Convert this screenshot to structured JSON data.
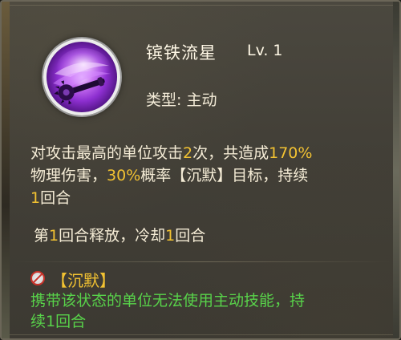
{
  "skill": {
    "name": "镔铁流星",
    "level": "Lv. 1",
    "type_label": "类型",
    "type_value": "主动",
    "icon": "purple-meteor-mace-icon"
  },
  "description": {
    "line1_a": "对攻击最高的单位攻击",
    "line1_b": "2",
    "line1_c": "次，共造成",
    "line1_d": "170%",
    "line2_a": "物理伤害，",
    "line2_b": "30%",
    "line2_c": "概率【沉默】目标，持续",
    "line3_a": "1",
    "line3_b": "回合"
  },
  "cooldown": {
    "a": "第",
    "b": "1",
    "c": "回合释放，冷却",
    "d": "1",
    "e": "回合"
  },
  "status": {
    "icon": "silence-icon",
    "name": "【沉默】",
    "desc_line1": "携带该状态的单位无法使用主动技能，持",
    "desc_line2": "续1回合"
  },
  "colors": {
    "highlight": "#f2c232",
    "status_text": "#58d24a",
    "body_text": "#f5ecd6"
  }
}
